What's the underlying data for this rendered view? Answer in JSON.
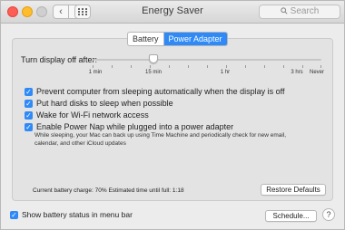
{
  "window": {
    "title": "Energy Saver",
    "search_placeholder": "Search"
  },
  "tabs": [
    {
      "label": "Battery",
      "active": false
    },
    {
      "label": "Power Adapter",
      "active": true
    }
  ],
  "slider": {
    "label": "Turn display off after:",
    "ticks": [
      "1 min",
      "15 min",
      "1 hr",
      "3 hrs",
      "Never"
    ],
    "selected": "15 min"
  },
  "options": [
    {
      "label": "Prevent computer from sleeping automatically when the display is off",
      "checked": true
    },
    {
      "label": "Put hard disks to sleep when possible",
      "checked": true
    },
    {
      "label": "Wake for Wi-Fi network access",
      "checked": true
    },
    {
      "label": "Enable Power Nap while plugged into a power adapter",
      "checked": true
    }
  ],
  "power_nap_description": "While sleeping, your Mac can back up using Time Machine and periodically check for new email, calendar, and other iCloud updates",
  "battery_status": "Current battery charge: 70%  Estimated time until full: 1:18",
  "buttons": {
    "restore_defaults": "Restore Defaults",
    "schedule": "Schedule...",
    "help": "?"
  },
  "show_battery_status": {
    "label": "Show battery status in menu bar",
    "checked": true
  },
  "colors": {
    "accent": "#2f8af7"
  },
  "icons": {
    "close": "close-icon",
    "minimize": "minimize-icon",
    "zoom": "zoom-icon",
    "back": "chevron-left-icon",
    "forward": "chevron-right-icon",
    "grid": "grid-icon",
    "search": "search-icon",
    "check": "checkmark-icon"
  }
}
